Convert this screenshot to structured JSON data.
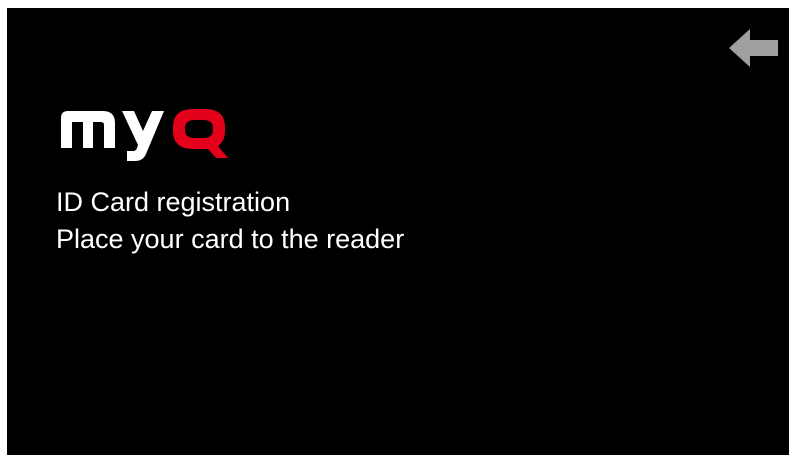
{
  "logo": {
    "text": "myQ",
    "colors": {
      "my": "#ffffff",
      "q": "#e3001b"
    }
  },
  "message": {
    "line1": "ID Card registration",
    "line2": "Place your card to the reader"
  },
  "back_button": {
    "icon": "arrow-left-icon",
    "color": "#a0a0a0"
  },
  "colors": {
    "background": "#000000",
    "text": "#ffffff"
  }
}
